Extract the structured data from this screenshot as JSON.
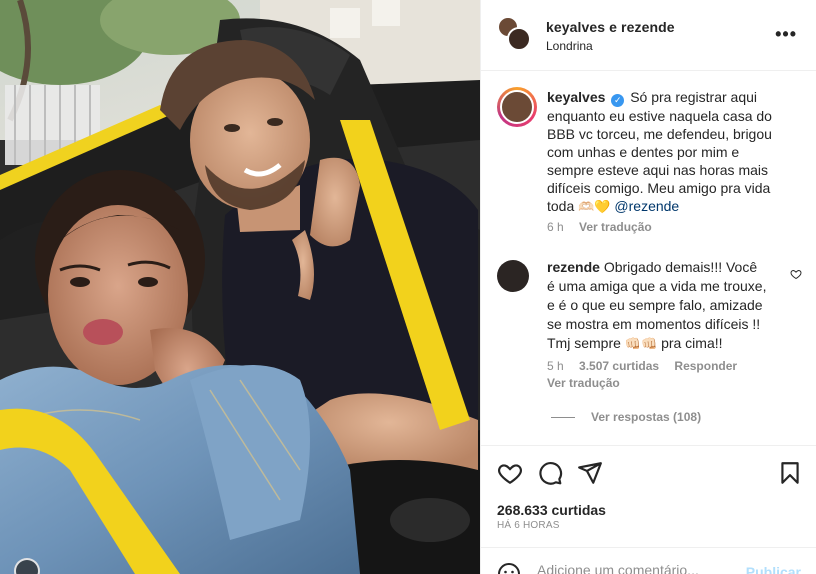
{
  "header": {
    "names": "keyalves e rezende",
    "location": "Londrina",
    "more_icon": "more-horizontal-icon"
  },
  "caption": {
    "username": "keyalves",
    "verified_mark": "✓",
    "lines": [
      "Só pra registrar aqui",
      "enquanto eu estive naquela casa do",
      "BBB vc torceu, me defendeu, brigou",
      "com unhas e dentes por mim e",
      "sempre esteve aqui nas horas mais",
      "difíceis comigo. Meu amigo pra vida"
    ],
    "last_line_prefix": "toda",
    "emojis": "🫶🏻💛",
    "mention": "@rezende",
    "time": "6 h",
    "see_translation": "Ver tradução"
  },
  "comment": {
    "username": "rezende",
    "lines": [
      "Obrigado demais!!! Você",
      "é uma amiga que a vida me trouxe,",
      "e é o que eu sempre falo, amizade",
      "se mostra em momentos difíceis !!"
    ],
    "last_line_prefix": "Tmj sempre",
    "emojis": "👊🏻👊🏻",
    "last_line_suffix": "pra cima!!",
    "time": "5 h",
    "likes": "3.507 curtidas",
    "reply": "Responder",
    "see_translation": "Ver tradução",
    "view_replies": "Ver respostas (108)"
  },
  "actions": {
    "likes": "268.633 curtidas",
    "timestamp": "HÁ 6 HORAS",
    "comment_placeholder": "Adicione um comentário...",
    "publish": "Publicar"
  },
  "colors": {
    "text": "#262626",
    "muted": "#8e8e8e",
    "link": "#00376b",
    "verified": "#3897f0",
    "publish_disabled": "#b2dffc",
    "seatbelt": "#f2d21c"
  }
}
